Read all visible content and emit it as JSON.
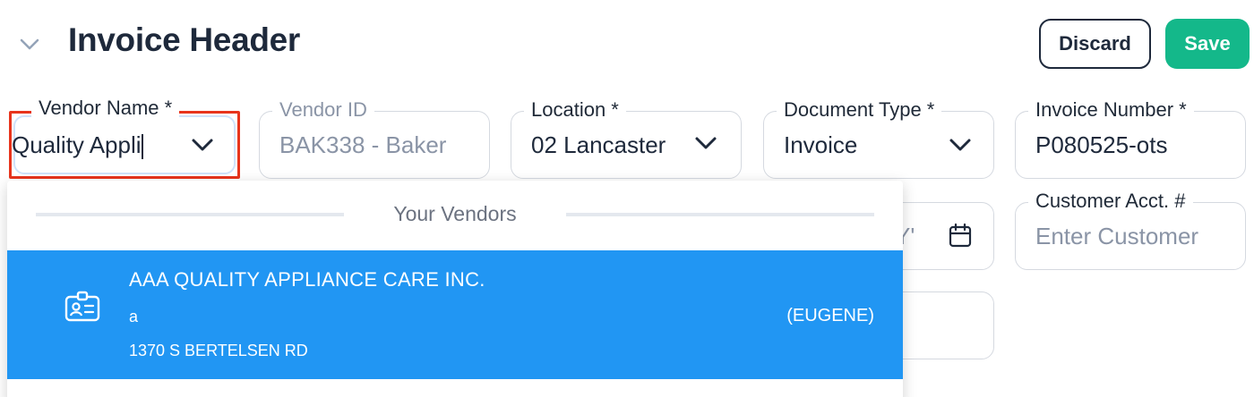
{
  "header": {
    "title": "Invoice Header",
    "discard_label": "Discard",
    "save_label": "Save"
  },
  "fields": {
    "vendor_name": {
      "label": "Vendor Name *",
      "value": "Quality Appli"
    },
    "vendor_id": {
      "label": "Vendor ID",
      "value": "BAK338 - Baker"
    },
    "location": {
      "label": "Location *",
      "value": "02 Lancaster"
    },
    "document_type": {
      "label": "Document Type *",
      "value": "Invoice"
    },
    "invoice_number": {
      "label": "Invoice Number *",
      "value": "P080525-ots"
    },
    "date": {
      "fragment": "Y'"
    },
    "customer_acct": {
      "label": "Customer Acct. #",
      "placeholder": "Enter Customer"
    }
  },
  "dropdown": {
    "section_title": "Your Vendors",
    "items": [
      {
        "name": "AAA QUALITY APPLIANCE CARE INC.",
        "sub": "a",
        "address": "1370 S BERTELSEN RD",
        "location": "(EUGENE)",
        "icon": "vendor-card-icon",
        "highlighted": true
      }
    ]
  },
  "colors": {
    "save_bg": "#14b88a",
    "highlight_bg": "#2196f3",
    "focus_outline": "#e8341c"
  }
}
